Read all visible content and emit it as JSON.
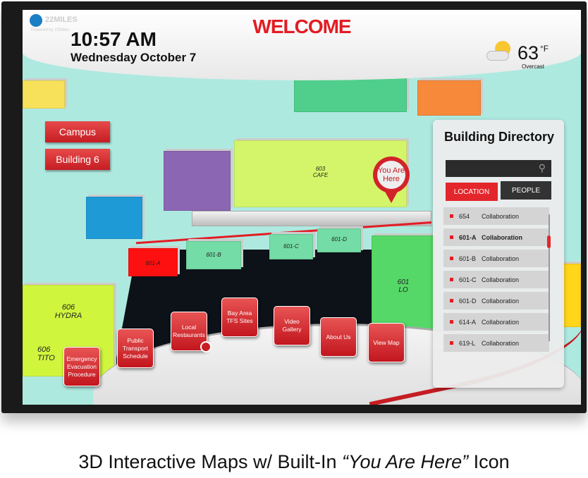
{
  "header": {
    "logo_text": "22MILES",
    "logo_sub": "Powered by 22Miles",
    "time": "10:57 AM",
    "date": "Wednesday October 7",
    "title": "WELCOME"
  },
  "weather": {
    "temp": "63",
    "unit": "°F",
    "condition": "Overcast",
    "icon": "partly-cloudy-icon"
  },
  "nav": {
    "campus": "Campus",
    "building": "Building 6"
  },
  "map": {
    "rooms": {
      "cafe": "603\nCAFE",
      "r601a": "601-A",
      "r601b": "601-B",
      "r601c": "601-C",
      "r601d": "601-D",
      "hydra": "606\nHYDRA",
      "tito": "606\nTITO",
      "lobby": "601\nLO"
    },
    "marker": "You Are\nHere",
    "colors": {
      "floor": "#aee9e0",
      "route": "#e31c24",
      "selected": "#ff1010"
    }
  },
  "directory": {
    "title": "Building Directory",
    "search_placeholder": "",
    "tabs": [
      "LOCATION",
      "PEOPLE"
    ],
    "active_tab": "LOCATION",
    "items": [
      {
        "room": "654",
        "type": "Collaboration"
      },
      {
        "room": "601-A",
        "type": "Collaboration",
        "selected": true
      },
      {
        "room": "601-B",
        "type": "Collaboration"
      },
      {
        "room": "601-C",
        "type": "Collaboration"
      },
      {
        "room": "601-D",
        "type": "Collaboration"
      },
      {
        "room": "614-A",
        "type": "Collaboration"
      },
      {
        "room": "619-L",
        "type": "Collaboration"
      }
    ]
  },
  "menu": [
    "Emergency Evacuation Procedure",
    "Public Transport Schedule",
    "Local Restaurants",
    "Bay Area TFS Sites",
    "Video Gallery",
    "About Us",
    "View Map"
  ],
  "caption": {
    "prefix": "3D Interactive Maps w/ Built-In ",
    "quote": "“You Are Here”",
    "suffix": " Icon"
  }
}
